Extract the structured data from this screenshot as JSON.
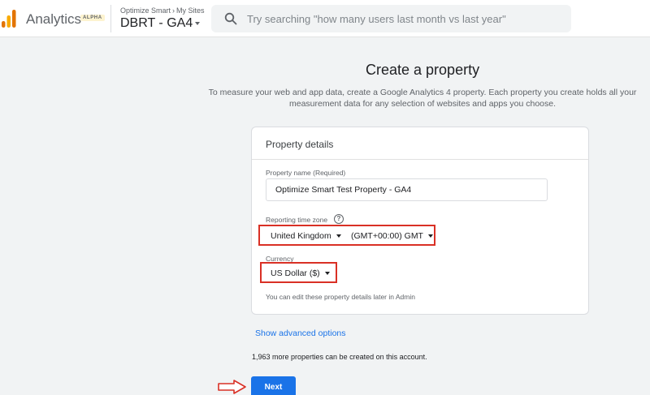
{
  "header": {
    "app_name": "Analytics",
    "badge": "ALPHA",
    "breadcrumb": [
      "Optimize Smart",
      "My Sites"
    ],
    "property_name": "DBRT - GA4",
    "search_placeholder": "Try searching \"how many users last month vs last year\""
  },
  "main": {
    "title": "Create a property",
    "intro": "To measure your web and app data, create a Google Analytics 4 property. Each property you create holds all your measurement data for any selection of websites and apps you choose.",
    "card": {
      "title": "Property details",
      "property_name_label": "Property name (Required)",
      "property_name_value": "Optimize Smart Test Property - GA4",
      "timezone_label": "Reporting time zone",
      "country_value": "United Kingdom",
      "timezone_value": "(GMT+00:00) GMT",
      "currency_label": "Currency",
      "currency_value": "US Dollar ($)",
      "note": "You can edit these property details later in Admin"
    },
    "advanced_link": "Show advanced options",
    "remaining_text": "1,963 more properties can be created on this account.",
    "next_label": "Next"
  },
  "colors": {
    "accent": "#1a73e8",
    "highlight": "#d93025",
    "logo_orange": "#f9ab00",
    "logo_dark_orange": "#e37400"
  }
}
